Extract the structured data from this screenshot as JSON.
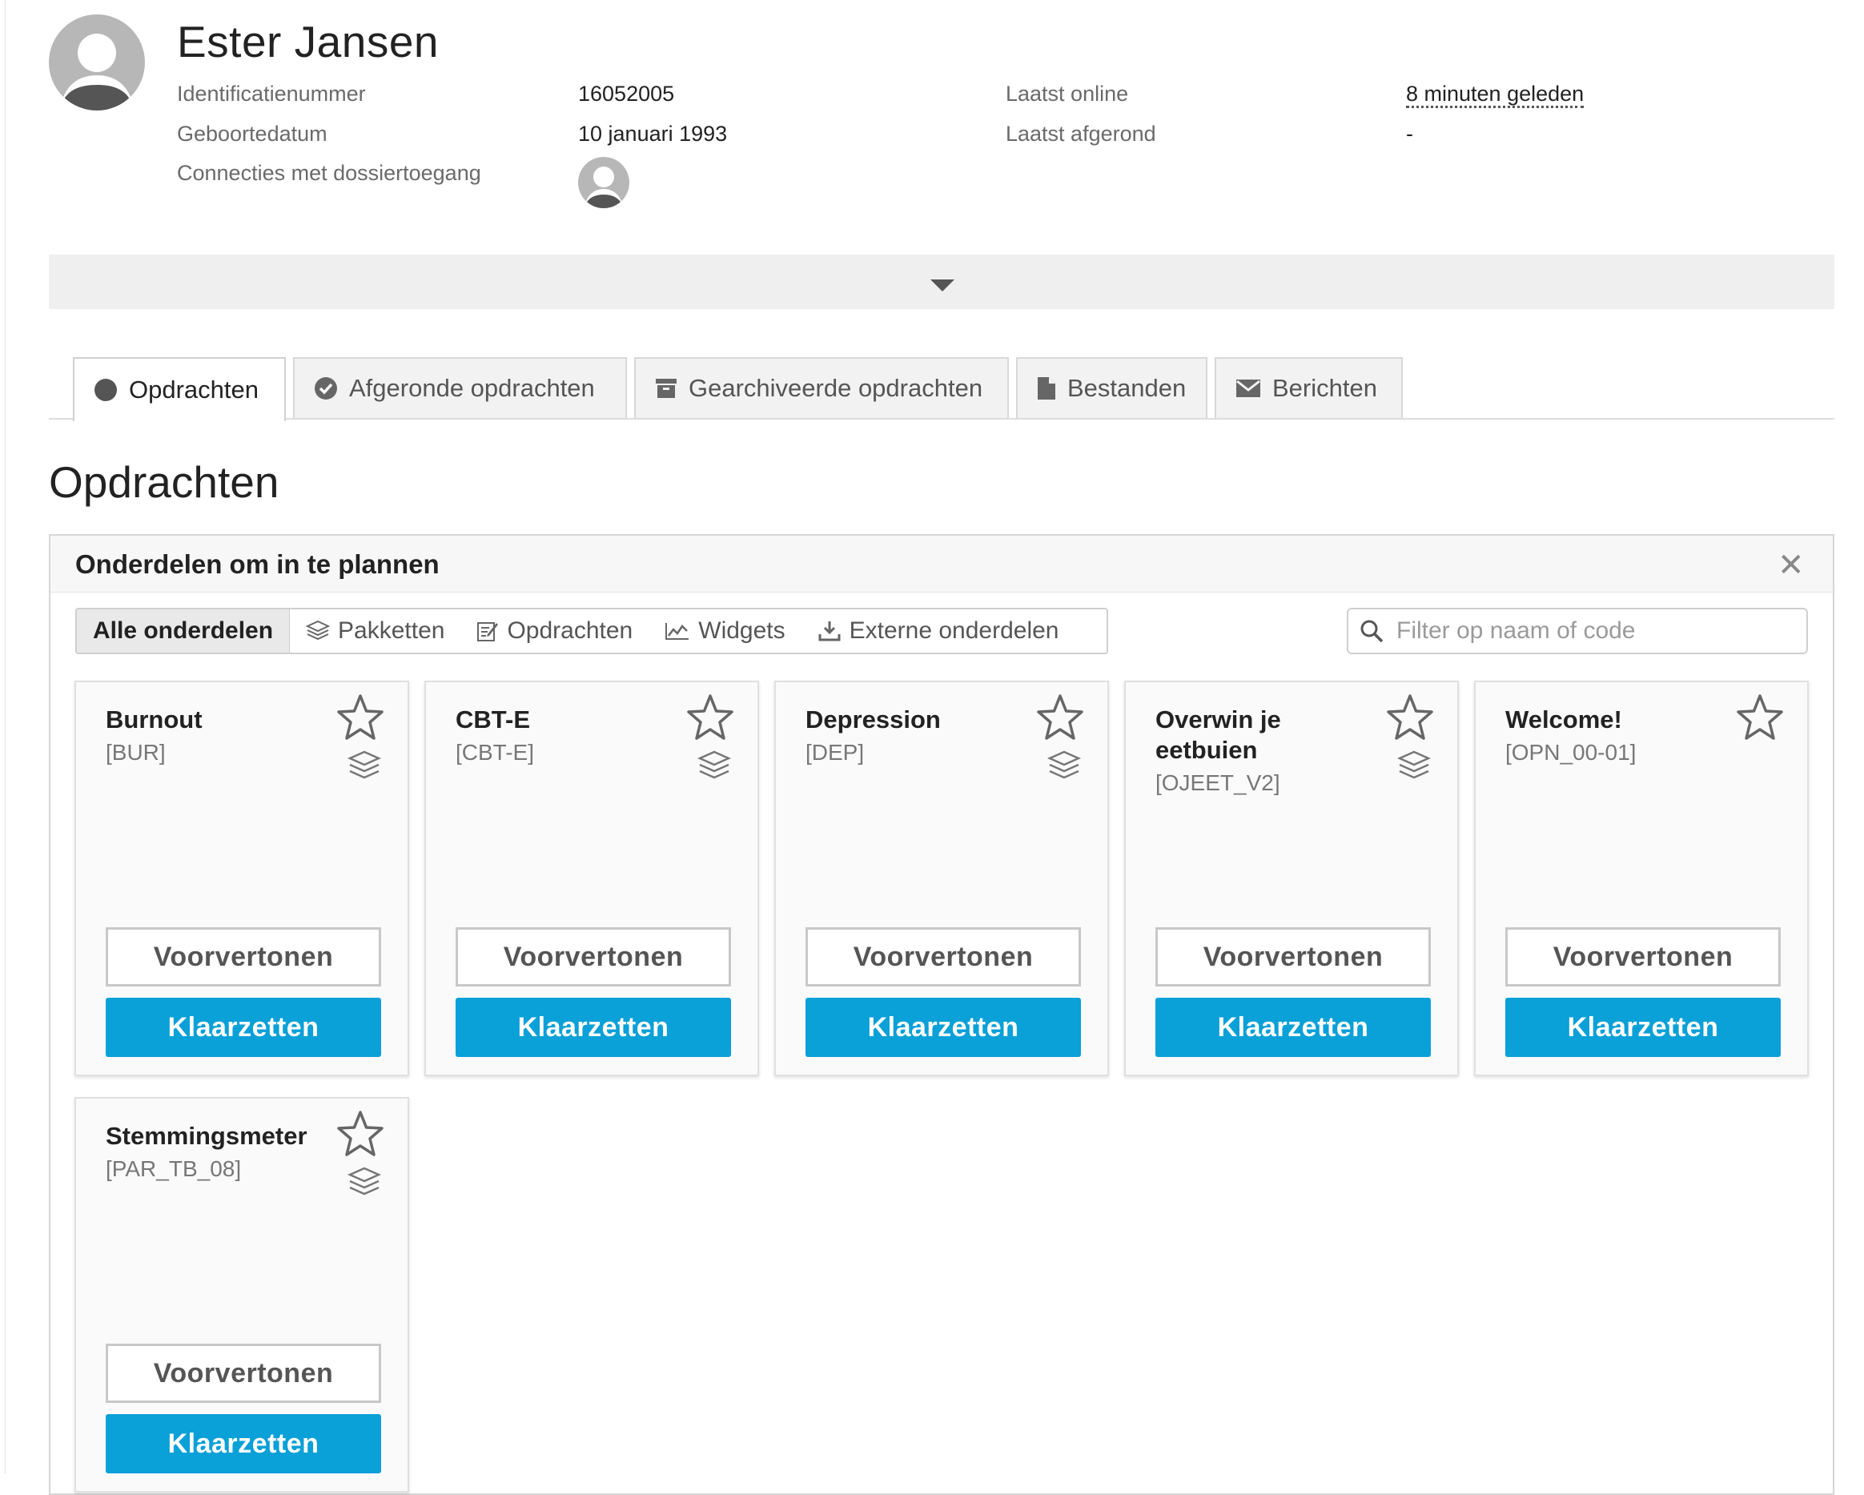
{
  "profile": {
    "name": "Ester Jansen",
    "id_label": "Identificatienummer",
    "id_value": "16052005",
    "dob_label": "Geboortedatum",
    "dob_value": "10 januari 1993",
    "connections_label": "Connecties met dossiertoegang",
    "last_online_label": "Laatst online",
    "last_online_value": "8 minuten geleden",
    "last_completed_label": "Laatst afgerond",
    "last_completed_value": "-"
  },
  "tabs": [
    {
      "label": "Opdrachten",
      "icon": "circle-icon",
      "active": true
    },
    {
      "label": "Afgeronde opdrachten",
      "icon": "check-circle-icon",
      "active": false
    },
    {
      "label": "Gearchiveerde opdrachten",
      "icon": "archive-icon",
      "active": false
    },
    {
      "label": "Bestanden",
      "icon": "file-icon",
      "active": false
    },
    {
      "label": "Berichten",
      "icon": "envelope-icon",
      "active": false
    }
  ],
  "page_title": "Opdrachten",
  "panel": {
    "title": "Onderdelen om in te plannen",
    "close": "✕",
    "filters": [
      "Alle onderdelen",
      "Pakketten",
      "Opdrachten",
      "Widgets",
      "Externe onderdelen"
    ],
    "active_filter": "Alle onderdelen",
    "search_placeholder": "Filter op naam of code"
  },
  "cards": [
    {
      "title": "Burnout",
      "code": "[BUR]",
      "preview": "Voorvertonen",
      "action": "Klaarzetten"
    },
    {
      "title": "CBT-E",
      "code": "[CBT-E]",
      "preview": "Voorvertonen",
      "action": "Klaarzetten"
    },
    {
      "title": "Depression",
      "code": "[DEP]",
      "preview": "Voorvertonen",
      "action": "Klaarzetten"
    },
    {
      "title": "Overwin je eetbuien",
      "code": "[OJEET_V2]",
      "preview": "Voorvertonen",
      "action": "Klaarzetten"
    },
    {
      "title": "Welcome!",
      "code": "[OPN_00-01]",
      "preview": "Voorvertonen",
      "action": "Klaarzetten"
    },
    {
      "title": "Stemmingsmeter",
      "code": "[PAR_TB_08]",
      "preview": "Voorvertonen",
      "action": "Klaarzetten"
    }
  ],
  "colors": {
    "primary": "#0aa0d8",
    "expander_bg": "#efefef"
  }
}
